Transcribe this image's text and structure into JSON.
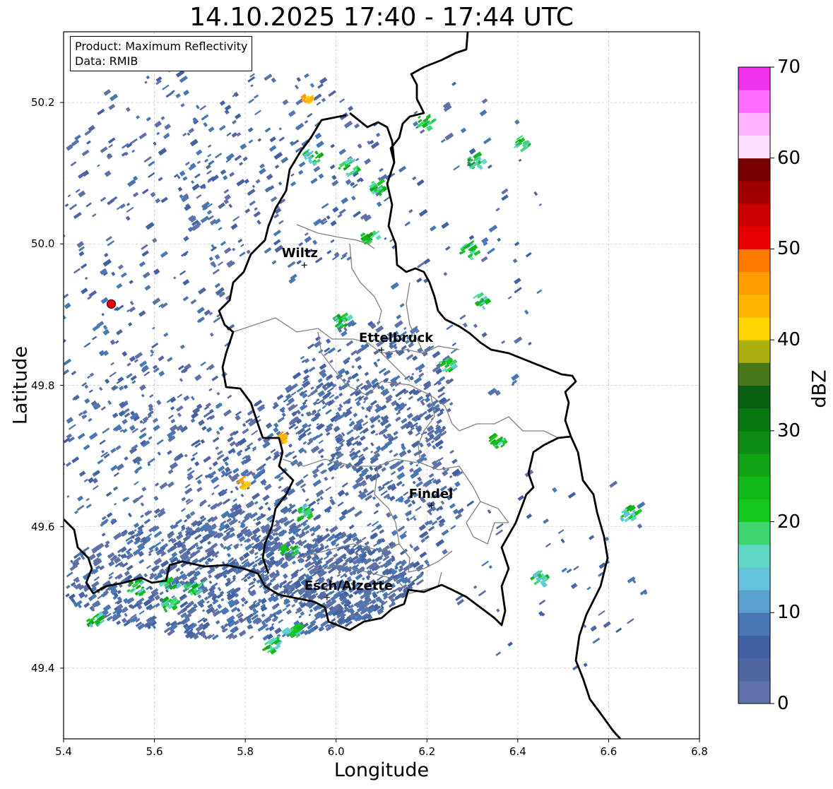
{
  "map": {
    "title": "14.10.2025 17:40 - 17:44 UTC",
    "info_lines": [
      "Product: Maximum Reflectivity",
      "Data: RMIB"
    ],
    "xlabel": "Longitude",
    "ylabel": "Latitude",
    "xlim": [
      5.4,
      6.8
    ],
    "ylim": [
      49.3,
      50.3
    ],
    "x_ticks": [
      "5.4",
      "5.6",
      "5.8",
      "6.0",
      "6.2",
      "6.4",
      "6.6",
      "6.8"
    ],
    "y_ticks": [
      "49.4",
      "49.6",
      "49.8",
      "50.0",
      "50.2"
    ],
    "grid": true,
    "cities": [
      {
        "name": "Wiltz",
        "lon": 5.93,
        "lat": 49.97
      },
      {
        "name": "Ettelbruck",
        "lon": 6.1,
        "lat": 49.85
      },
      {
        "name": "Findel",
        "lon": 6.21,
        "lat": 49.63
      },
      {
        "name": "Esch/Alzette",
        "lon": 5.98,
        "lat": 49.5
      }
    ],
    "radar_site": {
      "lon": 5.505,
      "lat": 49.915,
      "color": "#e8000b"
    },
    "colorbar": {
      "label": "dBZ",
      "min": 0,
      "max": 70,
      "ticks": [
        "0",
        "10",
        "20",
        "30",
        "40",
        "50",
        "60",
        "70"
      ],
      "colors": [
        "#6070a8",
        "#5066a0",
        "#4260a4",
        "#4878b4",
        "#5aa0cc",
        "#64c4dc",
        "#5ed8c4",
        "#3ed670",
        "#14c81c",
        "#10b818",
        "#10a414",
        "#0c8c12",
        "#087810",
        "#066010",
        "#48781a",
        "#acb00e",
        "#ffd400",
        "#ffb400",
        "#ff9c00",
        "#ff7c00",
        "#e60000",
        "#c80000",
        "#a00000",
        "#780000",
        "#ffe0ff",
        "#ffb4ff",
        "#ff6cff",
        "#ee32ee"
      ]
    }
  }
}
